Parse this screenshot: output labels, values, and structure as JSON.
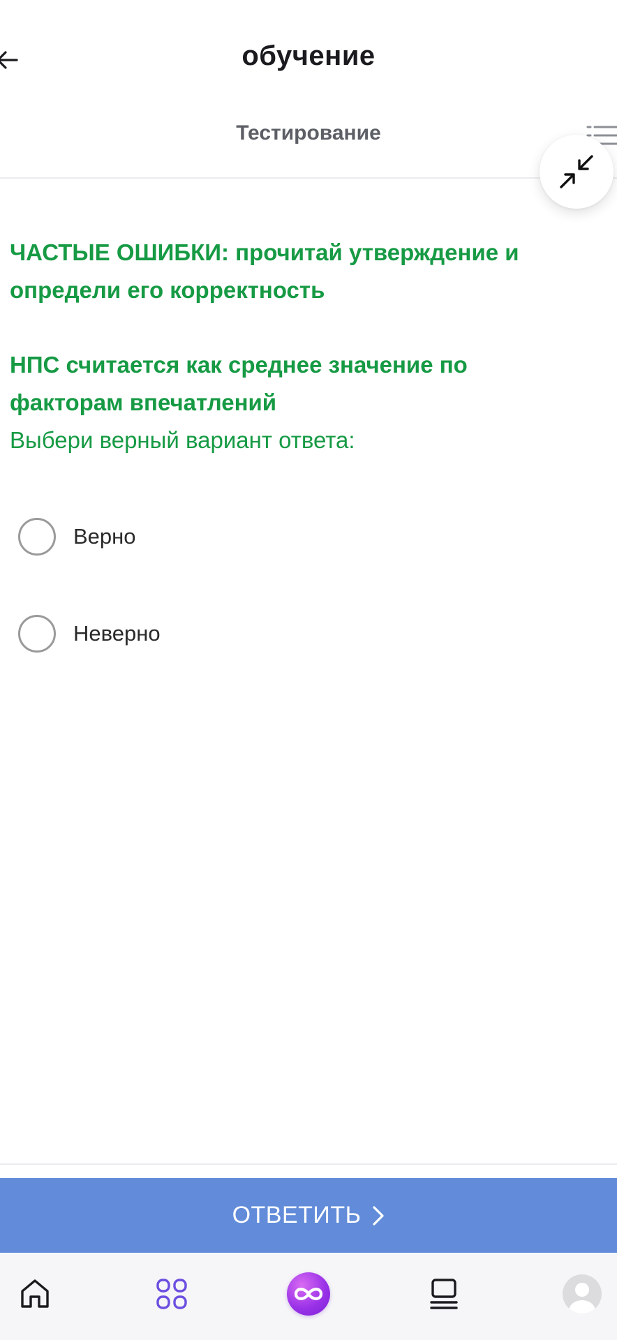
{
  "header": {
    "title": "обучение",
    "subtitle": "Тестирование"
  },
  "question": {
    "intro": "ЧАСТЫЕ ОШИБКИ: прочитай утверждение и определи его корректность",
    "statement": "НПС считается как среднее значение по факторам впечатлений",
    "instruction": "Выбери верный вариант ответа:"
  },
  "options": [
    {
      "label": "Верно",
      "selected": false
    },
    {
      "label": "Неверно",
      "selected": false
    }
  ],
  "submit": {
    "label": "ОТВЕТИТЬ"
  },
  "colors": {
    "accent_green": "#169a44",
    "submit_blue": "#628cd9",
    "tab_purple": "#6c4fe0",
    "center_purple": "#9b33e8"
  },
  "icons": {
    "back": "arrow-left-icon",
    "list": "list-icon",
    "collapse": "collapse-arrows-icon",
    "submit_chevron": "chevron-right-icon",
    "tabs": [
      "home-icon",
      "grid-icon",
      "infinity-icon",
      "feed-icon",
      "avatar-icon"
    ]
  }
}
